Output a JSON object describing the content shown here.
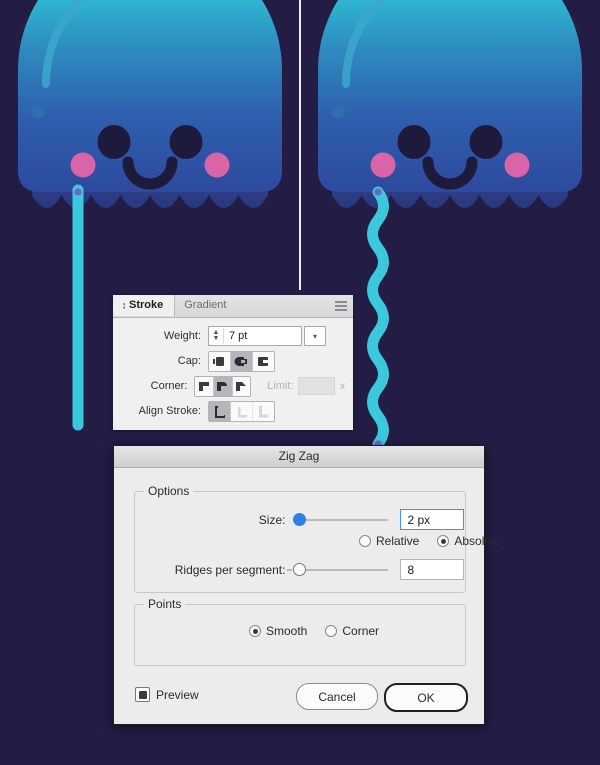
{
  "canvas": {
    "background_color": "#231d45",
    "divider_color": "#f2f2f4",
    "artwork_name": "jellyfish-illustration",
    "jellyfish": [
      {
        "name": "jellyfish-straight-tentacle",
        "bell_gradient_top": "#2fd4e0",
        "bell_gradient_bottom": "#2d4a9e",
        "skirt_color": "#2b3f86",
        "tentacle_color": "#3cc8dc",
        "tentacle_style": "straight",
        "eye_color": "#1e1a3c",
        "cheek_color": "#d964a8",
        "highlight_color": "#3aa8cf"
      },
      {
        "name": "jellyfish-zigzag-tentacle",
        "bell_gradient_top": "#2fd4e0",
        "bell_gradient_bottom": "#2d4a9e",
        "skirt_color": "#2b3f86",
        "tentacle_color": "#3cc8dc",
        "tentacle_style": "zigzag",
        "eye_color": "#1e1a3c",
        "cheek_color": "#d964a8",
        "highlight_color": "#3aa8cf"
      }
    ]
  },
  "stroke_panel": {
    "tabs": [
      {
        "label": "Stroke",
        "active": true
      },
      {
        "label": "Gradient",
        "active": false
      }
    ],
    "menu_icon": "panel-menu-icon",
    "weight": {
      "label": "Weight:",
      "value": "7 pt",
      "stepper_icon": "stepper-updown-icon",
      "dropdown_icon": "chevron-down-icon"
    },
    "cap": {
      "label": "Cap:",
      "options": [
        "butt-cap",
        "round-cap",
        "projecting-cap"
      ],
      "selected_index": 1
    },
    "corner": {
      "label": "Corner:",
      "options": [
        "miter-join",
        "round-join",
        "bevel-join"
      ],
      "selected_index": 1
    },
    "limit": {
      "label": "Limit:",
      "value": "",
      "unit": "x",
      "disabled": true
    },
    "align_stroke": {
      "label": "Align Stroke:",
      "options": [
        "align-center",
        "align-inside",
        "align-outside"
      ],
      "selected_index": 0,
      "disabled_indices": [
        1,
        2
      ]
    }
  },
  "dialog": {
    "title": "Zig Zag",
    "options_group": {
      "legend": "Options",
      "size": {
        "label": "Size:",
        "value": "2 px",
        "slider_percent": 3,
        "slider_knob": "filled"
      },
      "mode": {
        "options": [
          "Relative",
          "Absolute"
        ],
        "selected": "Absolute"
      },
      "ridges": {
        "label": "Ridges per segment:",
        "value": "8",
        "slider_percent": 4,
        "slider_knob": "hollow"
      }
    },
    "points_group": {
      "legend": "Points",
      "options": [
        "Smooth",
        "Corner"
      ],
      "selected": "Smooth"
    },
    "preview": {
      "label": "Preview",
      "checked": true
    },
    "buttons": [
      {
        "label": "Cancel",
        "name": "cancel-button",
        "default": false
      },
      {
        "label": "OK",
        "name": "ok-button",
        "default": true
      }
    ]
  }
}
